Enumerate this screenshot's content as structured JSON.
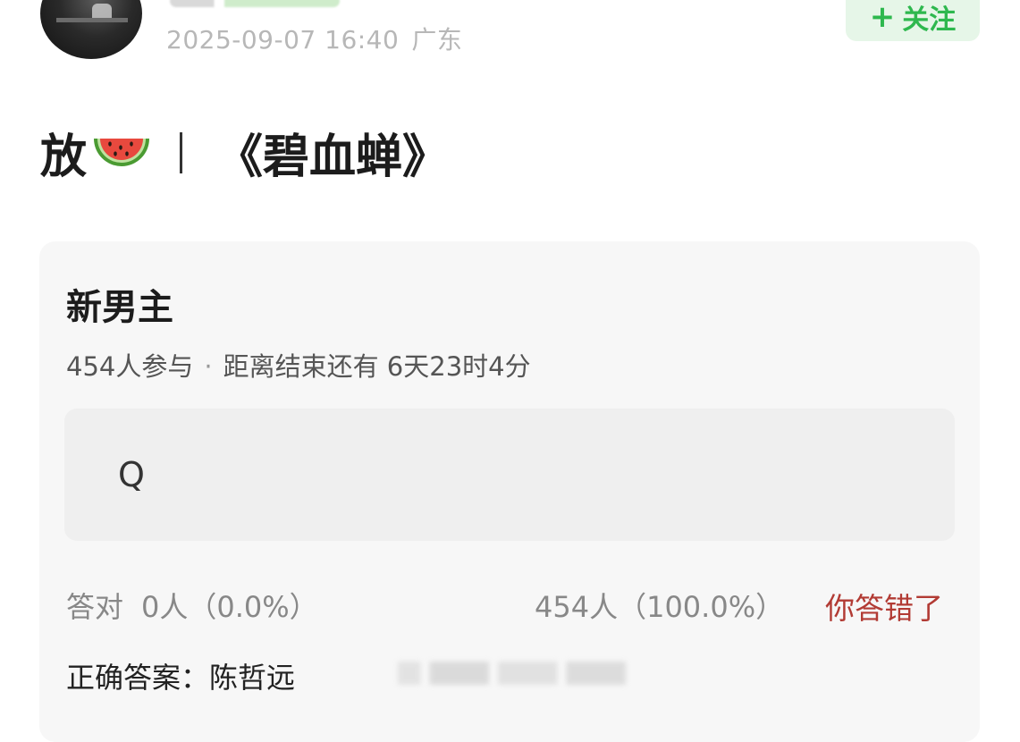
{
  "post": {
    "timestamp": "2025-09-07 16:40",
    "location": "广东",
    "follow_plus": "+",
    "follow_label": "关注",
    "title_prefix": "放",
    "title_emoji": "watermelon-emoji",
    "title_work": "《碧血蝉》"
  },
  "quiz": {
    "title": "新男主",
    "participants": "454人参与",
    "separator": "·",
    "countdown": "距离结束还有 6天23时4分",
    "answer_placeholder": "Q",
    "correct_label": "答对",
    "correct_count": "0人（0.0%）",
    "wrong_count": "454人（100.0%）",
    "result": "你答错了",
    "answer_line": "正确答案：陈哲远"
  },
  "colors": {
    "follow_green": "#2eb84e",
    "follow_bg": "#e6f6e8",
    "wrong_red": "#b23b34",
    "card_bg": "#f7f7f7"
  }
}
